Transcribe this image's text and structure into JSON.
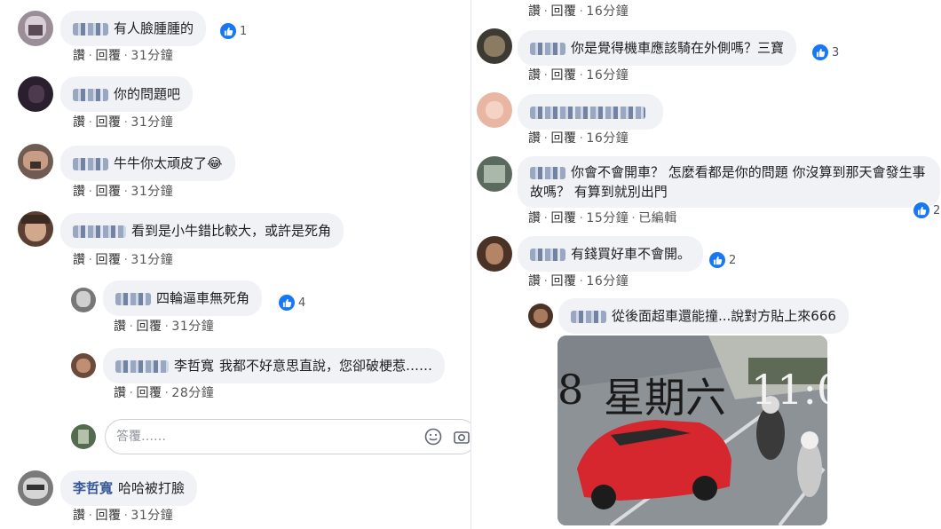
{
  "labels": {
    "like": "讚",
    "reply": "回覆",
    "sep": "·",
    "edited": "已編輯"
  },
  "left": {
    "comments": [
      {
        "text": "有人臉腫腫的",
        "time": "31分鐘",
        "reactions": "1"
      },
      {
        "text": "你的問題吧",
        "time": "31分鐘"
      },
      {
        "text": "牛牛你太頑皮了😂",
        "time": "31分鐘"
      },
      {
        "text": "看到是小牛錯比較大，或許是死角",
        "time": "31分鐘"
      },
      {
        "text": "四輪逼車無死角",
        "time": "31分鐘",
        "reactions": "4"
      },
      {
        "mention": "李哲寬",
        "text": "我都不好意思直說，您卻破梗惹……",
        "time": "28分鐘"
      },
      {
        "author": "李哲寬",
        "text": "哈哈被打臉",
        "time": "31分鐘"
      }
    ],
    "reply_input": {
      "placeholder": "答覆……"
    }
  },
  "right": {
    "top_actions_time": "16分鐘",
    "comments": [
      {
        "text": "你是覺得機車應該騎在外側嗎？三寶",
        "time": "16分鐘",
        "reactions": "3"
      },
      {
        "text": "",
        "time": "16分鐘"
      },
      {
        "text": "你會不會開車？ 怎麼看都是你的問題 你沒算到那天會發生事故嗎？ 有算到就別出門",
        "time": "15分鐘",
        "reactions": "2"
      },
      {
        "text": "有錢買好車不會開。",
        "time": "16分鐘",
        "reactions": "2"
      },
      {
        "text": "從後面超車還能撞...說對方貼上來666"
      }
    ],
    "photo": {
      "text_day": "星期六",
      "text_left": "8",
      "text_right": "11:0"
    }
  },
  "colors": {
    "like_blue": "#1877f2",
    "bubble_bg": "#f0f2f5",
    "name_link": "#385898"
  }
}
